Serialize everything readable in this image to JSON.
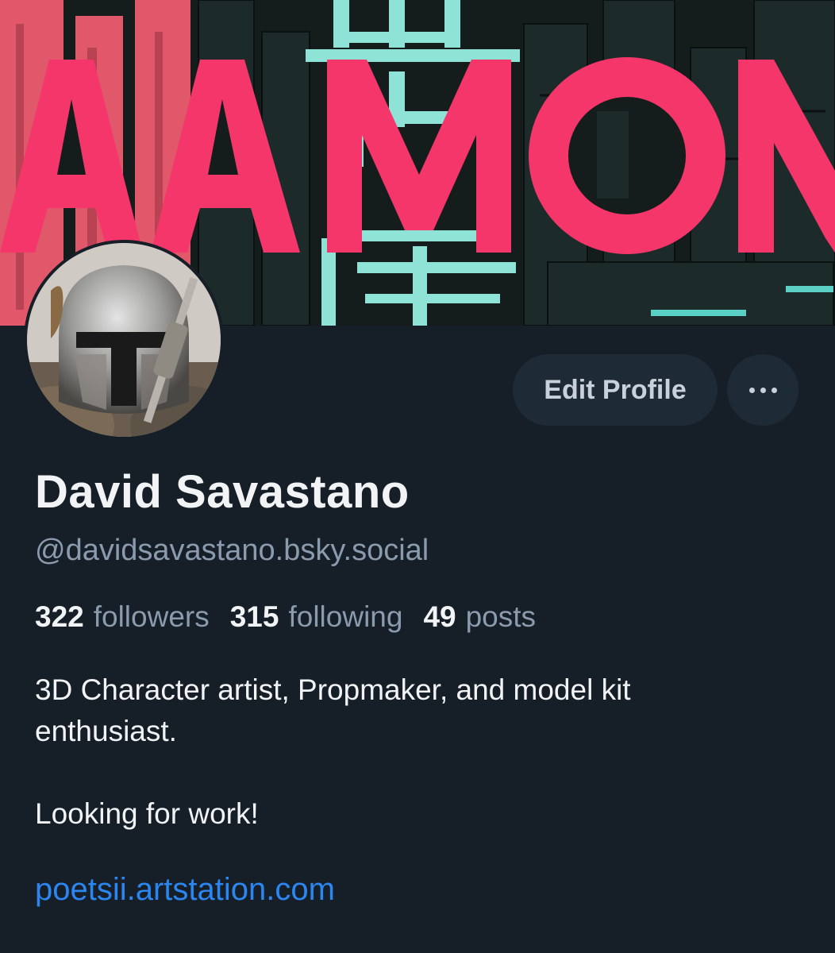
{
  "profile": {
    "display_name": "David Savastano",
    "handle": "@davidsavastano.bsky.social",
    "stats": [
      {
        "count": "322",
        "label": "followers"
      },
      {
        "count": "315",
        "label": "following"
      },
      {
        "count": "49",
        "label": "posts"
      }
    ],
    "bio_lines": [
      "3D Character artist, Propmaker, and model kit",
      "enthusiast.",
      "Looking for work!"
    ],
    "link": "poetsii.artstation.com"
  },
  "actions": {
    "edit_profile_label": "Edit Profile",
    "more_icon": "ellipsis-icon"
  },
  "banner": {
    "text": "AAMON",
    "colors": {
      "pink": "#f4366a",
      "teal": "#8fe3d6",
      "bg": "#141c1c"
    }
  },
  "theme": {
    "background": "#161e27",
    "button_bg": "#1e2a36",
    "link_color": "#2b86ef",
    "muted_text": "#8a9bae"
  }
}
